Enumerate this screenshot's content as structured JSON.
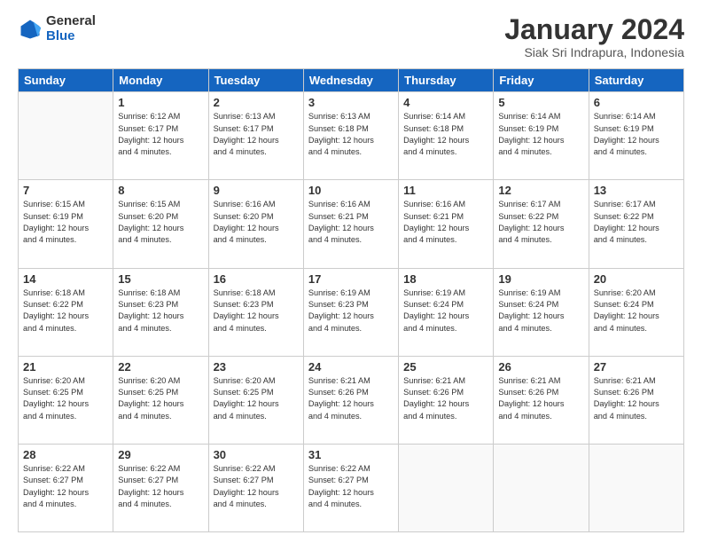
{
  "logo": {
    "general": "General",
    "blue": "Blue"
  },
  "header": {
    "month": "January 2024",
    "location": "Siak Sri Indrapura, Indonesia"
  },
  "weekdays": [
    "Sunday",
    "Monday",
    "Tuesday",
    "Wednesday",
    "Thursday",
    "Friday",
    "Saturday"
  ],
  "weeks": [
    [
      {
        "day": "",
        "info": ""
      },
      {
        "day": "1",
        "info": "Sunrise: 6:12 AM\nSunset: 6:17 PM\nDaylight: 12 hours\nand 4 minutes."
      },
      {
        "day": "2",
        "info": "Sunrise: 6:13 AM\nSunset: 6:17 PM\nDaylight: 12 hours\nand 4 minutes."
      },
      {
        "day": "3",
        "info": "Sunrise: 6:13 AM\nSunset: 6:18 PM\nDaylight: 12 hours\nand 4 minutes."
      },
      {
        "day": "4",
        "info": "Sunrise: 6:14 AM\nSunset: 6:18 PM\nDaylight: 12 hours\nand 4 minutes."
      },
      {
        "day": "5",
        "info": "Sunrise: 6:14 AM\nSunset: 6:19 PM\nDaylight: 12 hours\nand 4 minutes."
      },
      {
        "day": "6",
        "info": "Sunrise: 6:14 AM\nSunset: 6:19 PM\nDaylight: 12 hours\nand 4 minutes."
      }
    ],
    [
      {
        "day": "7",
        "info": "Sunrise: 6:15 AM\nSunset: 6:19 PM\nDaylight: 12 hours\nand 4 minutes."
      },
      {
        "day": "8",
        "info": "Sunrise: 6:15 AM\nSunset: 6:20 PM\nDaylight: 12 hours\nand 4 minutes."
      },
      {
        "day": "9",
        "info": "Sunrise: 6:16 AM\nSunset: 6:20 PM\nDaylight: 12 hours\nand 4 minutes."
      },
      {
        "day": "10",
        "info": "Sunrise: 6:16 AM\nSunset: 6:21 PM\nDaylight: 12 hours\nand 4 minutes."
      },
      {
        "day": "11",
        "info": "Sunrise: 6:16 AM\nSunset: 6:21 PM\nDaylight: 12 hours\nand 4 minutes."
      },
      {
        "day": "12",
        "info": "Sunrise: 6:17 AM\nSunset: 6:22 PM\nDaylight: 12 hours\nand 4 minutes."
      },
      {
        "day": "13",
        "info": "Sunrise: 6:17 AM\nSunset: 6:22 PM\nDaylight: 12 hours\nand 4 minutes."
      }
    ],
    [
      {
        "day": "14",
        "info": "Sunrise: 6:18 AM\nSunset: 6:22 PM\nDaylight: 12 hours\nand 4 minutes."
      },
      {
        "day": "15",
        "info": "Sunrise: 6:18 AM\nSunset: 6:23 PM\nDaylight: 12 hours\nand 4 minutes."
      },
      {
        "day": "16",
        "info": "Sunrise: 6:18 AM\nSunset: 6:23 PM\nDaylight: 12 hours\nand 4 minutes."
      },
      {
        "day": "17",
        "info": "Sunrise: 6:19 AM\nSunset: 6:23 PM\nDaylight: 12 hours\nand 4 minutes."
      },
      {
        "day": "18",
        "info": "Sunrise: 6:19 AM\nSunset: 6:24 PM\nDaylight: 12 hours\nand 4 minutes."
      },
      {
        "day": "19",
        "info": "Sunrise: 6:19 AM\nSunset: 6:24 PM\nDaylight: 12 hours\nand 4 minutes."
      },
      {
        "day": "20",
        "info": "Sunrise: 6:20 AM\nSunset: 6:24 PM\nDaylight: 12 hours\nand 4 minutes."
      }
    ],
    [
      {
        "day": "21",
        "info": "Sunrise: 6:20 AM\nSunset: 6:25 PM\nDaylight: 12 hours\nand 4 minutes."
      },
      {
        "day": "22",
        "info": "Sunrise: 6:20 AM\nSunset: 6:25 PM\nDaylight: 12 hours\nand 4 minutes."
      },
      {
        "day": "23",
        "info": "Sunrise: 6:20 AM\nSunset: 6:25 PM\nDaylight: 12 hours\nand 4 minutes."
      },
      {
        "day": "24",
        "info": "Sunrise: 6:21 AM\nSunset: 6:26 PM\nDaylight: 12 hours\nand 4 minutes."
      },
      {
        "day": "25",
        "info": "Sunrise: 6:21 AM\nSunset: 6:26 PM\nDaylight: 12 hours\nand 4 minutes."
      },
      {
        "day": "26",
        "info": "Sunrise: 6:21 AM\nSunset: 6:26 PM\nDaylight: 12 hours\nand 4 minutes."
      },
      {
        "day": "27",
        "info": "Sunrise: 6:21 AM\nSunset: 6:26 PM\nDaylight: 12 hours\nand 4 minutes."
      }
    ],
    [
      {
        "day": "28",
        "info": "Sunrise: 6:22 AM\nSunset: 6:27 PM\nDaylight: 12 hours\nand 4 minutes."
      },
      {
        "day": "29",
        "info": "Sunrise: 6:22 AM\nSunset: 6:27 PM\nDaylight: 12 hours\nand 4 minutes."
      },
      {
        "day": "30",
        "info": "Sunrise: 6:22 AM\nSunset: 6:27 PM\nDaylight: 12 hours\nand 4 minutes."
      },
      {
        "day": "31",
        "info": "Sunrise: 6:22 AM\nSunset: 6:27 PM\nDaylight: 12 hours\nand 4 minutes."
      },
      {
        "day": "",
        "info": ""
      },
      {
        "day": "",
        "info": ""
      },
      {
        "day": "",
        "info": ""
      }
    ]
  ]
}
